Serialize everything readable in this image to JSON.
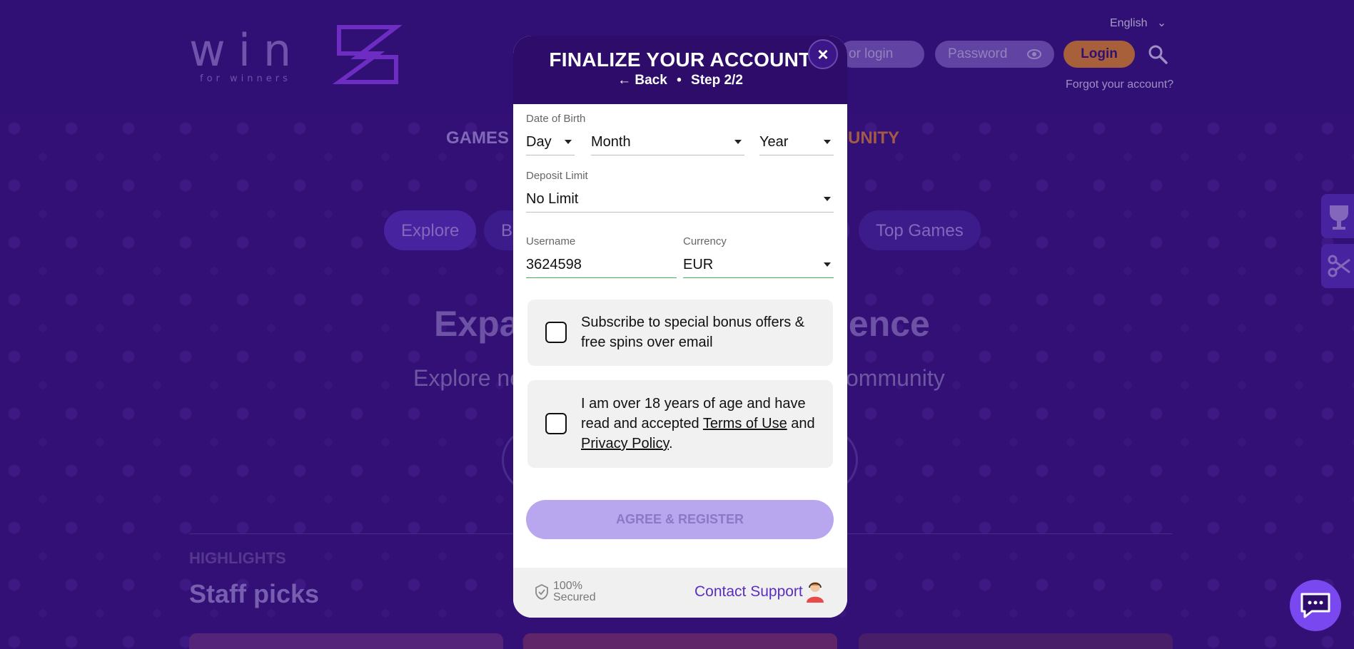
{
  "background": {
    "language": "English",
    "login_placeholder": "or login",
    "password_placeholder": "Password",
    "login_button": "Login",
    "forgot": "Forgot your account?",
    "nav_games": "GAMES",
    "nav_community": "MUNITY",
    "pills": [
      "Explore",
      "Bi",
      "Top Games"
    ],
    "hero_title_left": "Expa",
    "hero_title_right": "ience",
    "hero_sub_left": "Explore ne",
    "hero_sub_right": "ommunity",
    "highlights": "HIGHLIGHTS",
    "staff_picks": "Staff picks",
    "logo_text": "win",
    "logo_tagline": "for winners"
  },
  "modal": {
    "title": "FINALIZE YOUR ACCOUNT",
    "back_label": "Back",
    "step_label": "Step 2/2",
    "close": "×",
    "dob_label": "Date of Birth",
    "dob_day": "Day",
    "dob_month": "Month",
    "dob_year": "Year",
    "deposit_label": "Deposit Limit",
    "deposit_value": "No Limit",
    "username_label": "Username",
    "username_value": "3624598",
    "currency_label": "Currency",
    "currency_value": "EUR",
    "subscribe_text": "Subscribe to special bonus offers & free spins over email",
    "age_text_1": "I am over 18 years of age and have read and accepted ",
    "terms_link": "Terms of Use",
    "age_text_2": " and ",
    "privacy_link": "Privacy Policy",
    "age_text_3": ".",
    "register_button": "AGREE & REGISTER",
    "secured_line1": "100%",
    "secured_line2": "Secured",
    "contact_support": "Contact Support"
  },
  "colors": {
    "modal_header": "#2e0d6a",
    "accent": "#5a2fc0",
    "register_disabled": "#b8a6ee"
  }
}
